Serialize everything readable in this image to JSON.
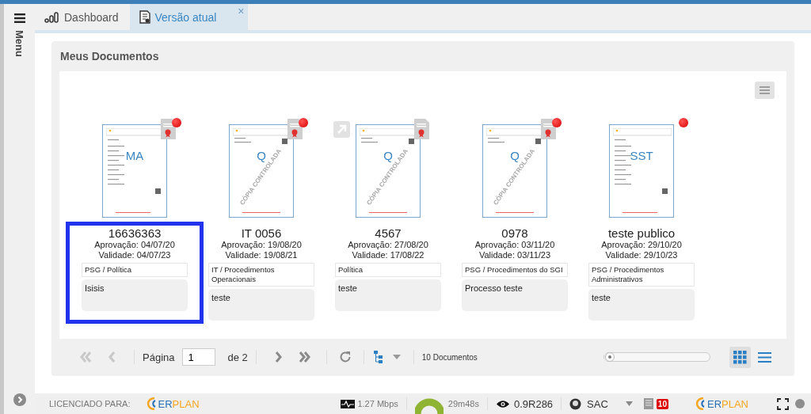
{
  "sidebar": {
    "label": "Menu"
  },
  "tabs": [
    {
      "label": "Dashboard",
      "selected": false
    },
    {
      "label": "Versão atual",
      "selected": true,
      "close": "×"
    }
  ],
  "panel": {
    "title": "Meus Documentos"
  },
  "documents": [
    {
      "thumb_label": "MA",
      "signed": true,
      "alert": true,
      "shortcut": false,
      "title": "16636363",
      "approval": "Aprovação: 04/07/20",
      "validity": "Validade: 04/07/23",
      "category": "PSG / Política",
      "description": "Isisis",
      "selected": true
    },
    {
      "thumb_label": "Q",
      "watermark": "CÓPIA CONTROLADA",
      "signed": true,
      "alert": true,
      "shortcut": false,
      "title": "IT 0056",
      "approval": "Aprovação: 19/08/20",
      "validity": "Validade: 19/08/21",
      "category": "IT / Procedimentos Operacionais",
      "description": "teste",
      "selected": false
    },
    {
      "thumb_label": "Q",
      "watermark": "CÓPIA CONTROLADA",
      "signed": true,
      "alert": false,
      "shortcut": true,
      "title": "4567",
      "approval": "Aprovação: 27/08/20",
      "validity": "Validade: 17/08/22",
      "category": "Política",
      "description": "teste",
      "selected": false
    },
    {
      "thumb_label": "Q",
      "watermark": "CÓPIA CONTROLADA",
      "signed": true,
      "alert": true,
      "shortcut": false,
      "title": "0978",
      "approval": "Aprovação: 03/11/20",
      "validity": "Validade: 03/11/23",
      "category": "PSG / Procedimentos do SGI",
      "description": "Processo teste",
      "selected": false
    },
    {
      "thumb_label": "SST",
      "signed": false,
      "alert": true,
      "shortcut": false,
      "title": "teste publico",
      "approval": "Aprovação: 29/10/20",
      "validity": "Validade: 29/10/23",
      "category": "PSG / Procedimentos Administrativos",
      "description": "teste",
      "selected": false
    }
  ],
  "pager": {
    "nav": [
      {
        "kind": "first",
        "disabled": true
      },
      {
        "kind": "prev",
        "disabled": true
      },
      {
        "kind": "next",
        "disabled": false
      },
      {
        "kind": "last",
        "disabled": false
      }
    ],
    "page_label": "Página",
    "page": "1",
    "of": "de 2",
    "count": "10 Documentos",
    "zoom": {
      "level": 0.02
    },
    "views": [
      {
        "kind": "grid",
        "selected": true
      },
      {
        "kind": "list",
        "selected": false
      }
    ]
  },
  "status_bar": {
    "license_label": "LICENCIADO PARA:",
    "logos": [
      {
        "first": "ER",
        "second": "PLAN"
      },
      {
        "first": "ER",
        "second": "PLAN"
      }
    ],
    "speed": "1.27 Mbps",
    "session": "29m48s",
    "version": "0.9R286",
    "support": "SAC",
    "notifications": "10"
  }
}
